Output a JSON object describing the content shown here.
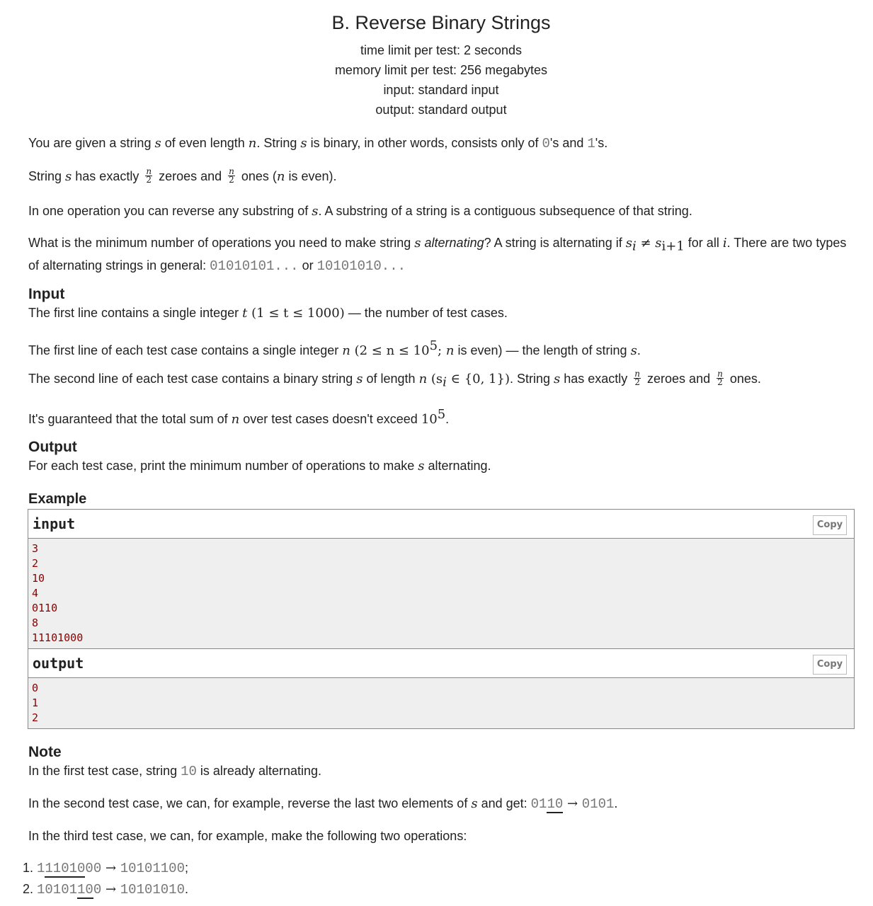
{
  "header": {
    "title": "B. Reverse Binary Strings",
    "time_limit": "time limit per test: 2 seconds",
    "memory_limit": "memory limit per test: 256 megabytes",
    "input": "input: standard input",
    "output": "output: standard output"
  },
  "statement": {
    "p1": {
      "a": "You are given a string ",
      "s1": "s",
      "b": " of even length ",
      "n": "n",
      "c": ". String ",
      "s2": "s",
      "d": " is binary, in other words, consists only of ",
      "zero": "0",
      "e": "'s and ",
      "one": "1",
      "f": "'s."
    },
    "p2": {
      "a": "String ",
      "s": "s",
      "b": " has exactly ",
      "frac_num": "n",
      "frac_den": "2",
      "c": " zeroes and ",
      "d": " ones (",
      "n": "n",
      "e": " is even)."
    },
    "p3": {
      "a": "In one operation you can reverse any substring of ",
      "s": "s",
      "b": ". A substring of a string is a contiguous subsequence of that string."
    },
    "p4": {
      "a": "What is the minimum number of operations you need to make string ",
      "s": "s",
      "alt": "alternating",
      "b": "? A string is alternating if ",
      "si": "s",
      "i": "i",
      "neq": " ≠ ",
      "si1": "s",
      "i1": "i+1",
      "c": " for all ",
      "ii": "i",
      "d": ". There are two types of alternating strings in general: ",
      "alt1": "01010101...",
      "or": " or ",
      "alt2": "10101010..."
    }
  },
  "input_section": {
    "title": "Input",
    "p1": {
      "a": "The first line contains a single integer ",
      "t": "t",
      "math": " (1 ≤ t ≤ 1000)",
      "b": " — the number of test cases."
    },
    "p2": {
      "a": "The first line of each test case contains a single integer ",
      "n": "n",
      "math": " (2 ≤ n ≤ 10",
      "exp": "5",
      "math2": "; ",
      "n2": "n",
      "b": " is even) — the length of string ",
      "s": "s",
      "c": "."
    },
    "p3": {
      "a": "The second line of each test case contains a binary string ",
      "s": "s",
      "b": " of length ",
      "n": "n",
      "math": " (s",
      "sub": "i",
      "math2": " ∈ {0, 1})",
      "c": ". String ",
      "s2": "s",
      "d": " has exactly ",
      "frac_num": "n",
      "frac_den": "2",
      "e": " zeroes and ",
      "f": " ones."
    },
    "p4": {
      "a": "It's guaranteed that the total sum of ",
      "n": "n",
      "b": " over test cases doesn't exceed ",
      "math": "10",
      "exp": "5",
      "c": "."
    }
  },
  "output_section": {
    "title": "Output",
    "p1": {
      "a": "For each test case, print the minimum number of operations to make ",
      "s": "s",
      "b": " alternating."
    }
  },
  "example": {
    "title": "Example",
    "input_label": "input",
    "output_label": "output",
    "copy_label": "Copy",
    "input_lines": [
      "3",
      "2",
      "10",
      "4",
      "0110",
      "8",
      "11101000"
    ],
    "output_lines": [
      "0",
      "1",
      "2"
    ]
  },
  "note": {
    "title": "Note",
    "p1": {
      "a": "In the first test case, string ",
      "code": "10",
      "b": " is already alternating."
    },
    "p2": {
      "a": "In the second test case, we can, for example, reverse the last two elements of ",
      "s": "s",
      "b": " and get: ",
      "from_pre": "01",
      "from_u": "10",
      "arrow": " → ",
      "to": "0101",
      "c": "."
    },
    "p3": "In the third test case, we can, for example, make the following two operations:",
    "ops": [
      {
        "pre": "1",
        "u": "11010",
        "post": "00",
        "arrow": " → ",
        "to": "10101100",
        "end": ";"
      },
      {
        "pre": "10101",
        "u": "10",
        "post": "0",
        "arrow": " → ",
        "to": "10101010",
        "end": "."
      }
    ]
  }
}
